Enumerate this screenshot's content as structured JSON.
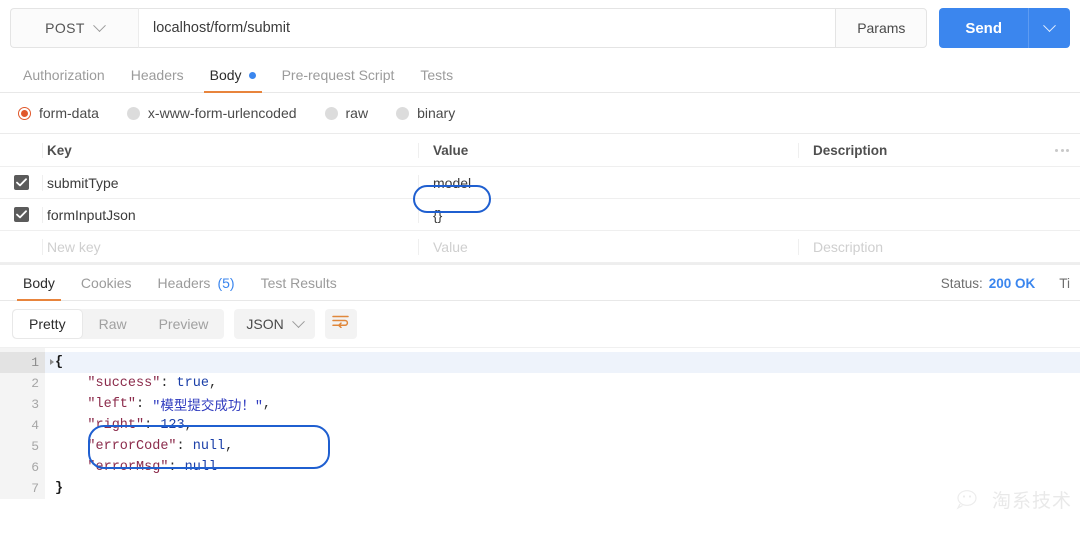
{
  "request_bar": {
    "method": "POST",
    "method_caret_icon": "chevron-down-icon",
    "url": "localhost/form/submit",
    "params_label": "Params",
    "send_label": "Send",
    "send_caret_icon": "chevron-down-icon"
  },
  "request_tabs": [
    {
      "label": "Authorization",
      "active": false,
      "dot": false
    },
    {
      "label": "Headers",
      "active": false,
      "dot": false
    },
    {
      "label": "Body",
      "active": true,
      "dot": true
    },
    {
      "label": "Pre-request Script",
      "active": false,
      "dot": false
    },
    {
      "label": "Tests",
      "active": false,
      "dot": false
    }
  ],
  "body_types": [
    {
      "label": "form-data",
      "selected": true
    },
    {
      "label": "x-www-form-urlencoded",
      "selected": false
    },
    {
      "label": "raw",
      "selected": false
    },
    {
      "label": "binary",
      "selected": false
    }
  ],
  "kv_table": {
    "headers": {
      "key": "Key",
      "value": "Value",
      "description": "Description",
      "more_icon": "ellipsis-icon"
    },
    "rows": [
      {
        "checked": true,
        "key": "submitType",
        "value": "model",
        "description": "",
        "highlighted_value": true
      },
      {
        "checked": true,
        "key": "formInputJson",
        "value": "{}",
        "description": "",
        "highlighted_value": false
      }
    ],
    "new_row": {
      "key_placeholder": "New key",
      "value_placeholder": "Value",
      "description_placeholder": "Description"
    }
  },
  "response_tabs": [
    {
      "label": "Body",
      "count": "",
      "active": true
    },
    {
      "label": "Cookies",
      "count": "",
      "active": false
    },
    {
      "label": "Headers",
      "count": "(5)",
      "active": false
    },
    {
      "label": "Test Results",
      "count": "",
      "active": false
    }
  ],
  "response_status": {
    "status_label": "Status:",
    "status_value": "200 OK",
    "time_label_truncated": "Ti"
  },
  "pretty_bar": {
    "views": [
      {
        "label": "Pretty",
        "active": true
      },
      {
        "label": "Raw",
        "active": false
      },
      {
        "label": "Preview",
        "active": false
      }
    ],
    "language": "JSON",
    "language_caret_icon": "chevron-down-icon",
    "wrap_icon": "wrap-lines-icon"
  },
  "code": {
    "line_numbers": [
      "1",
      "2",
      "3",
      "4",
      "5",
      "6",
      "7"
    ],
    "lines": [
      {
        "indent": 0,
        "tokens": [
          {
            "t": "brace",
            "v": "{"
          }
        ]
      },
      {
        "indent": 1,
        "tokens": [
          {
            "t": "key",
            "v": "\"success\""
          },
          {
            "t": "punc",
            "v": ": "
          },
          {
            "t": "atom",
            "v": "true"
          },
          {
            "t": "punc",
            "v": ","
          }
        ]
      },
      {
        "indent": 1,
        "tokens": [
          {
            "t": "key",
            "v": "\"left\""
          },
          {
            "t": "punc",
            "v": ": "
          },
          {
            "t": "str",
            "v": "\"模型提交成功！\""
          },
          {
            "t": "punc",
            "v": ","
          }
        ]
      },
      {
        "indent": 1,
        "tokens": [
          {
            "t": "key",
            "v": "\"right\""
          },
          {
            "t": "punc",
            "v": ": "
          },
          {
            "t": "num",
            "v": "123"
          },
          {
            "t": "punc",
            "v": ","
          }
        ]
      },
      {
        "indent": 1,
        "tokens": [
          {
            "t": "key",
            "v": "\"errorCode\""
          },
          {
            "t": "punc",
            "v": ": "
          },
          {
            "t": "atom",
            "v": "null"
          },
          {
            "t": "punc",
            "v": ","
          }
        ]
      },
      {
        "indent": 1,
        "tokens": [
          {
            "t": "key",
            "v": "\"errorMsg\""
          },
          {
            "t": "punc",
            "v": ": "
          },
          {
            "t": "atom",
            "v": "null"
          }
        ]
      },
      {
        "indent": 0,
        "tokens": [
          {
            "t": "brace",
            "v": "}"
          }
        ]
      }
    ]
  },
  "watermark": {
    "text": "淘系技术",
    "icon": "wechat-logo-icon"
  },
  "colors": {
    "accent_orange": "#e8843c",
    "send_blue": "#3b86ee",
    "radio_orange": "#e0572a",
    "annotation_blue": "#1f5fd0",
    "status_blue": "#3b86ee"
  }
}
